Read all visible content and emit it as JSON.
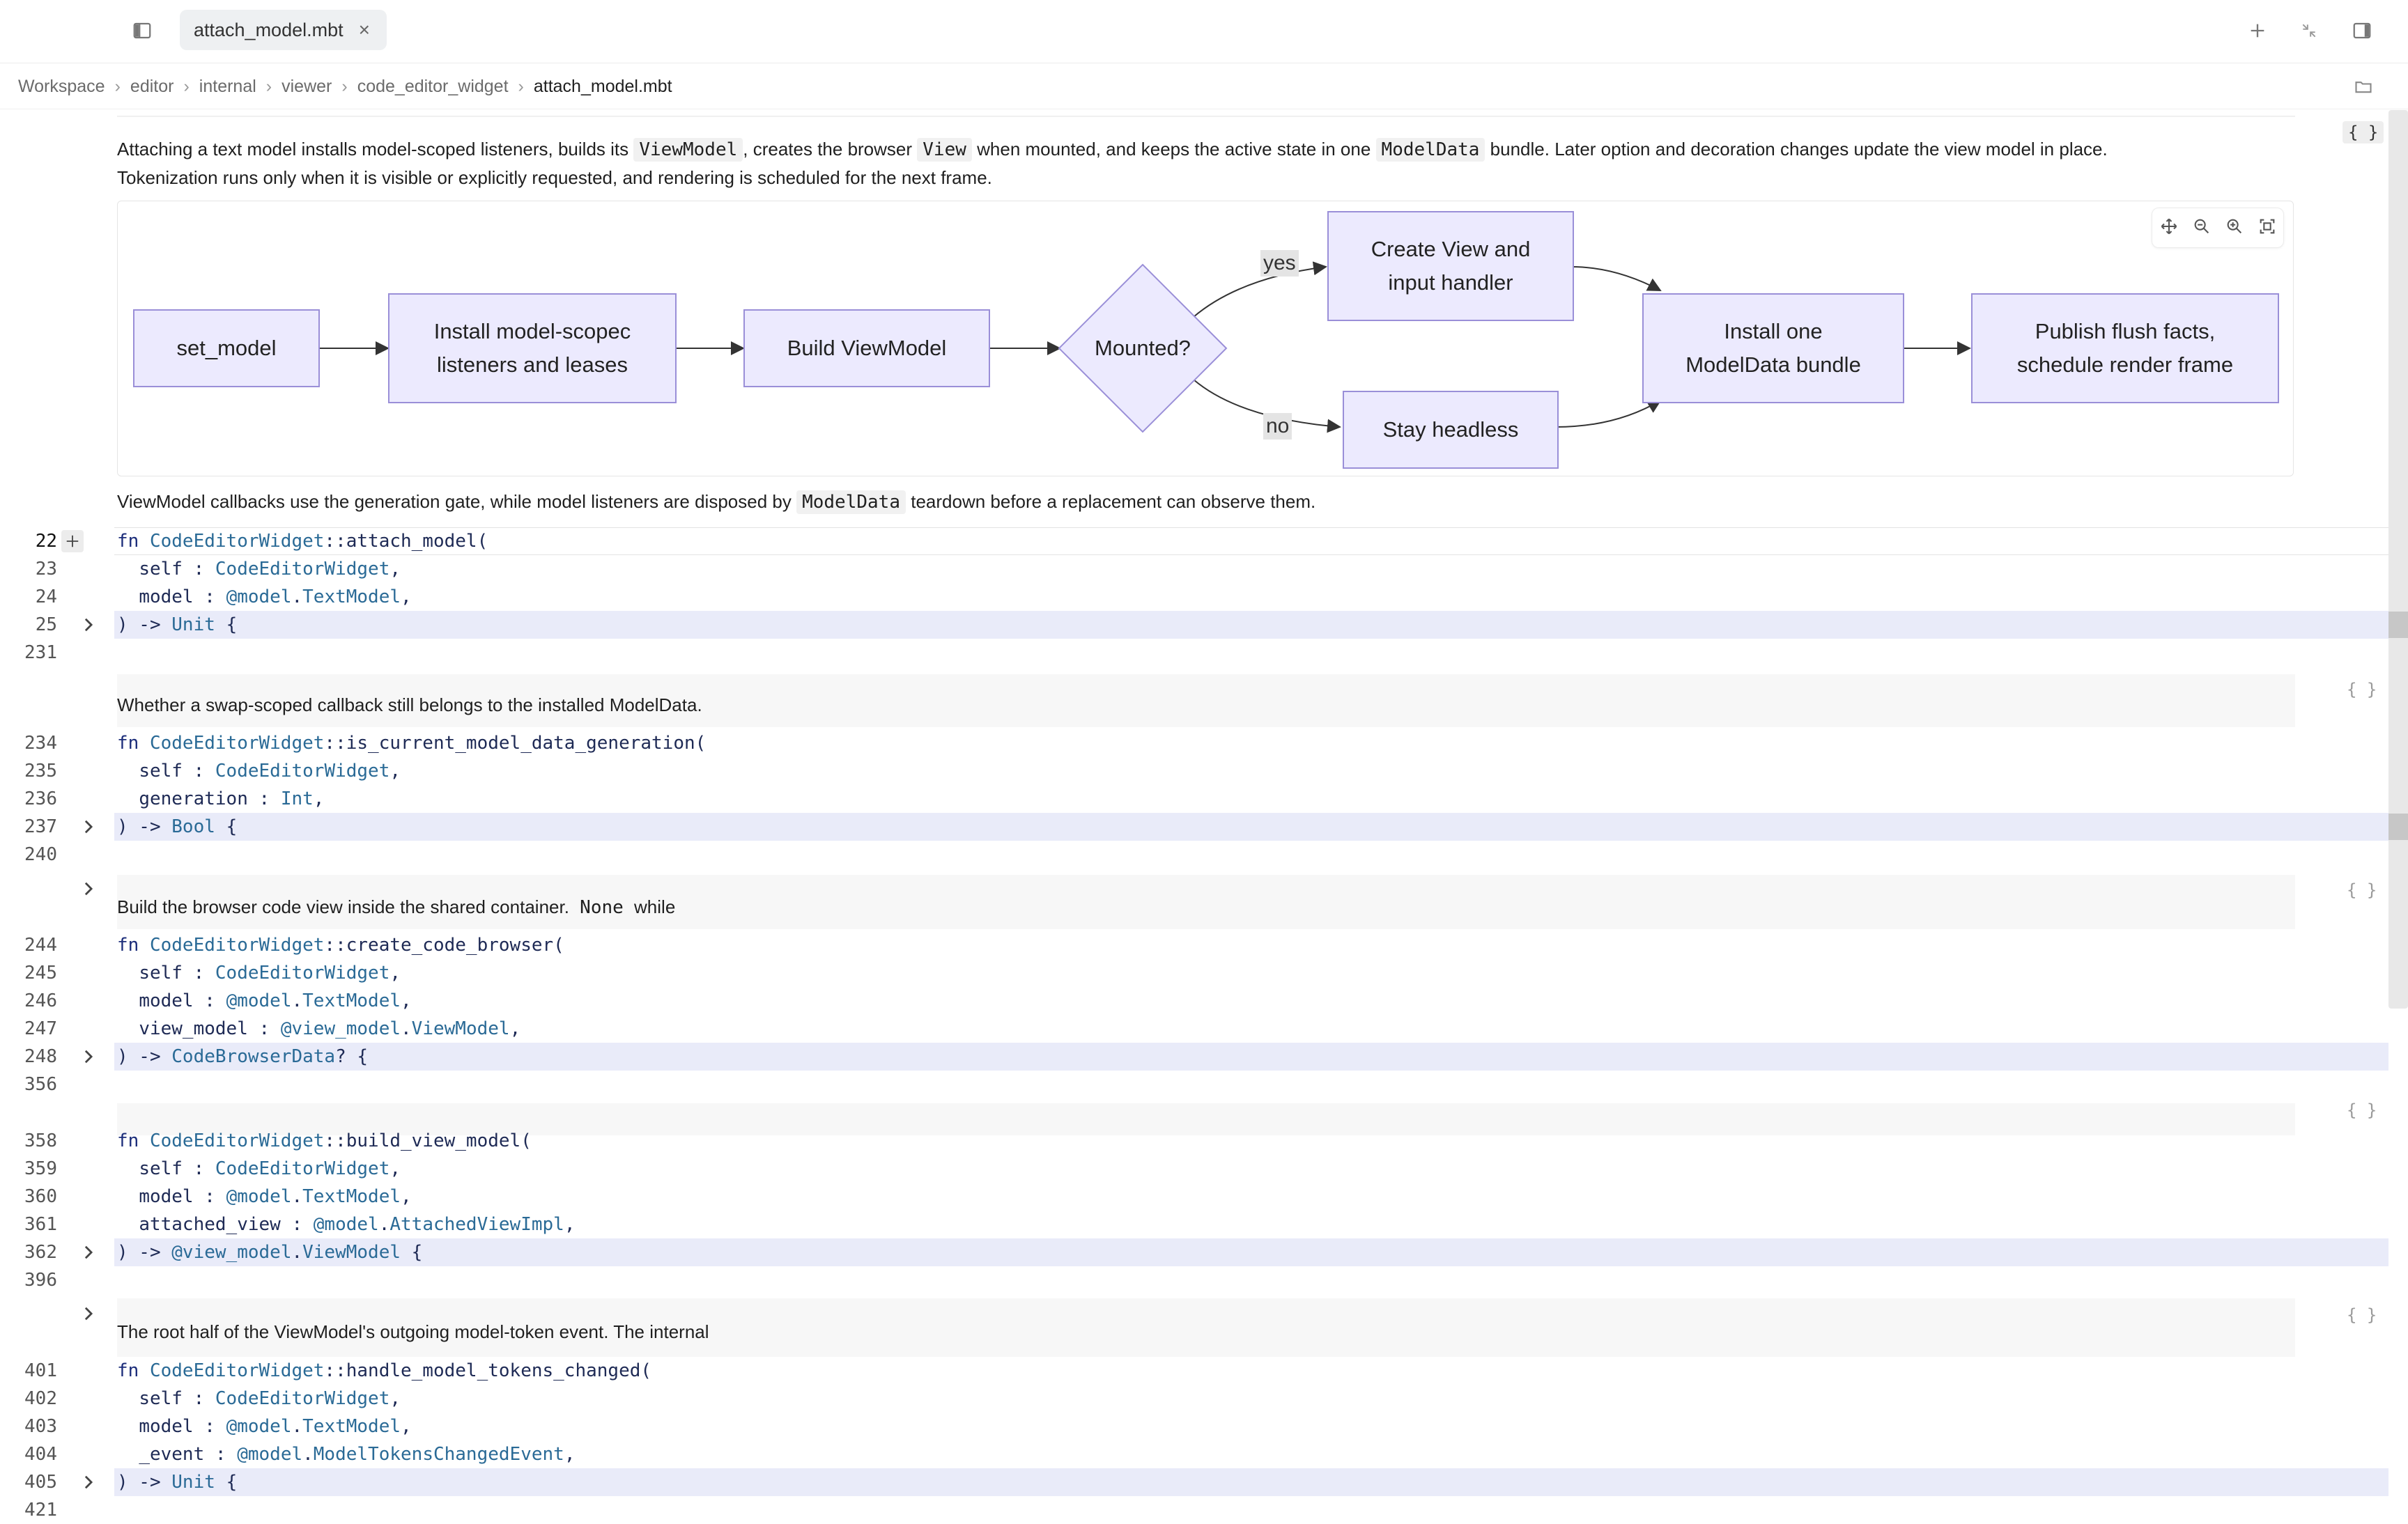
{
  "topbar": {
    "tab_label": "attach_model.mbt",
    "tab_close": "×"
  },
  "breadcrumb": {
    "items": [
      "Workspace",
      "editor",
      "internal",
      "viewer",
      "code_editor_widget"
    ],
    "current": "attach_model.mbt",
    "separator": "›"
  },
  "doc1": {
    "p1": "Attaching a text model installs model-scoped listeners, builds its",
    "c1": "ViewModel",
    "p2": ", creates the browser",
    "c2": "View",
    "p3": "when mounted, and keeps the active state in one",
    "c3": "ModelData",
    "p4": "bundle. Later option and decoration changes update the view model in place.",
    "line2": "Tokenization runs only when it is visible or explicitly requested, and rendering is scheduled for the next frame.",
    "brace": "{ }"
  },
  "diagram": {
    "nodes": {
      "set_model": "set_model",
      "install_l1": "Install model-scopec",
      "install_l2": "listeners and leases",
      "build": "Build ViewModel",
      "mounted": "Mounted?",
      "create_l1": "Create View and",
      "create_l2": "input handler",
      "headless": "Stay headless",
      "install_one_l1": "Install one",
      "install_one_l2": "ModelData bundle",
      "publish_l1": "Publish flush facts,",
      "publish_l2": "schedule render frame"
    },
    "edges": {
      "yes": "yes",
      "no": "no"
    }
  },
  "doc1b": {
    "p1": "ViewModel callbacks use the generation gate, while model listeners are disposed by",
    "c1": "ModelData",
    "p2": "teardown before a replacement can observe them."
  },
  "fn1": {
    "lines": [
      "22",
      "23",
      "24",
      "25",
      "231"
    ],
    "name": "attach_model(",
    "self_type": "CodeEditorWidget",
    "param2": "model",
    "param2_pkg": "@model",
    "param2_type": "TextModel",
    "ret": "Unit"
  },
  "doc2": {
    "text": "Whether a swap-scoped callback still belongs to the installed ModelData.",
    "brace": "{ }"
  },
  "fn2": {
    "lines": [
      "234",
      "235",
      "236",
      "237",
      "240"
    ],
    "name": "is_current_model_data_generation(",
    "param2": "generation",
    "param2_type": "Int",
    "ret": "Bool"
  },
  "doc3": {
    "p1": "Build the browser code view inside the shared container.",
    "c1": "None",
    "p2": "while",
    "brace": "{ }"
  },
  "fn3": {
    "lines": [
      "244",
      "245",
      "246",
      "247",
      "248",
      "356"
    ],
    "name": "create_code_browser(",
    "param3": "view_model",
    "param3_pkg": "@view_model",
    "param3_type": "ViewModel",
    "ret": "CodeBrowserData"
  },
  "doc4": {
    "brace": "{ }"
  },
  "fn4": {
    "lines": [
      "358",
      "359",
      "360",
      "361",
      "362",
      "396"
    ],
    "name": "build_view_model(",
    "param3": "attached_view",
    "param3_type": "AttachedViewImpl",
    "ret_pkg": "@view_model",
    "ret": "ViewModel"
  },
  "doc5": {
    "text": "The root half of the ViewModel's outgoing model-token event. The internal",
    "brace": "{ }"
  },
  "fn5": {
    "lines": [
      "401",
      "402",
      "403",
      "404",
      "405",
      "421"
    ],
    "name": "handle_model_tokens_changed(",
    "param3": "_event",
    "param3_type": "ModelTokensChangedEvent",
    "ret": "Unit"
  },
  "common": {
    "kw_fn": "fn",
    "cls": "CodeEditorWidget",
    "sep": "::",
    "self": "self",
    "colon": ":",
    "arrow": ") ->",
    "open": "{",
    "model": "model",
    "model_pkg": "@model",
    "textmodel": "TextModel",
    "qmark": "?"
  },
  "colors": {
    "accent": "#1c2d7a",
    "type": "#2a6a96",
    "highlight": "#e9ebf9",
    "node_fill": "#eceafe",
    "node_border": "#9a8fd8"
  },
  "icons": [
    "sidebar-toggle-icon",
    "plus-icon",
    "collapse-icon",
    "panel-right-icon",
    "folder-icon",
    "move-icon",
    "zoom-out-icon",
    "zoom-in-icon",
    "fit-icon",
    "chevron-right-icon"
  ]
}
